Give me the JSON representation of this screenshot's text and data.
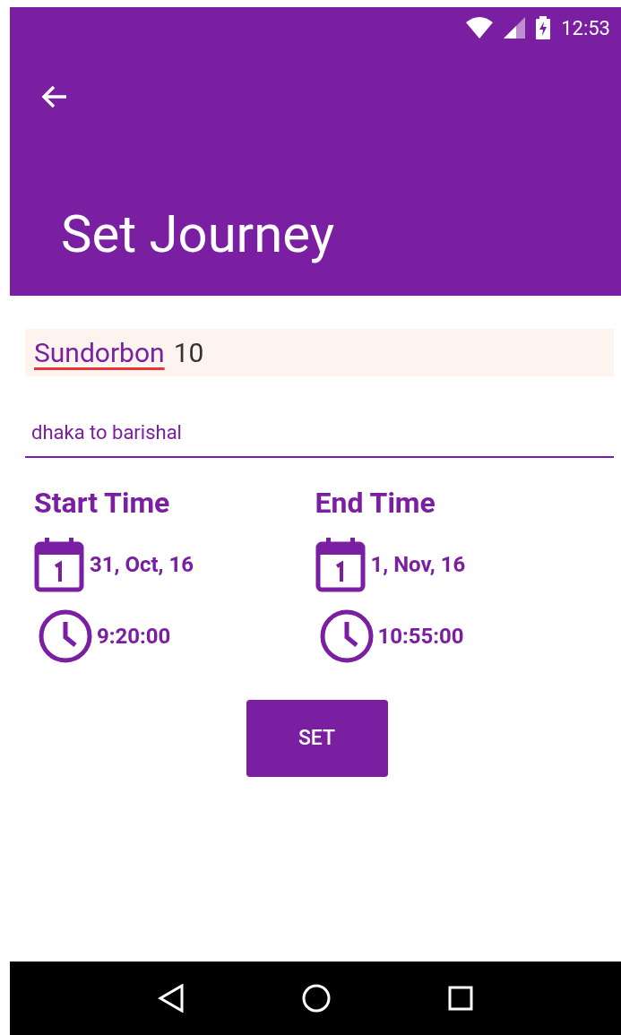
{
  "status_bar": {
    "time": "12:53"
  },
  "app_bar": {
    "title": "Set Journey"
  },
  "name_field": {
    "segments": [
      {
        "text": "Sundorbon",
        "misspelled": true
      },
      {
        "text": "10",
        "misspelled": false
      }
    ]
  },
  "route_field": {
    "value": "dhaka to barishal"
  },
  "columns": [
    {
      "heading": "Start Time",
      "date": "31, Oct, 16",
      "time": "9:20:00"
    },
    {
      "heading": "End Time",
      "date": "1, Nov, 16",
      "time": "10:55:00"
    }
  ],
  "button": {
    "label": "SET"
  }
}
